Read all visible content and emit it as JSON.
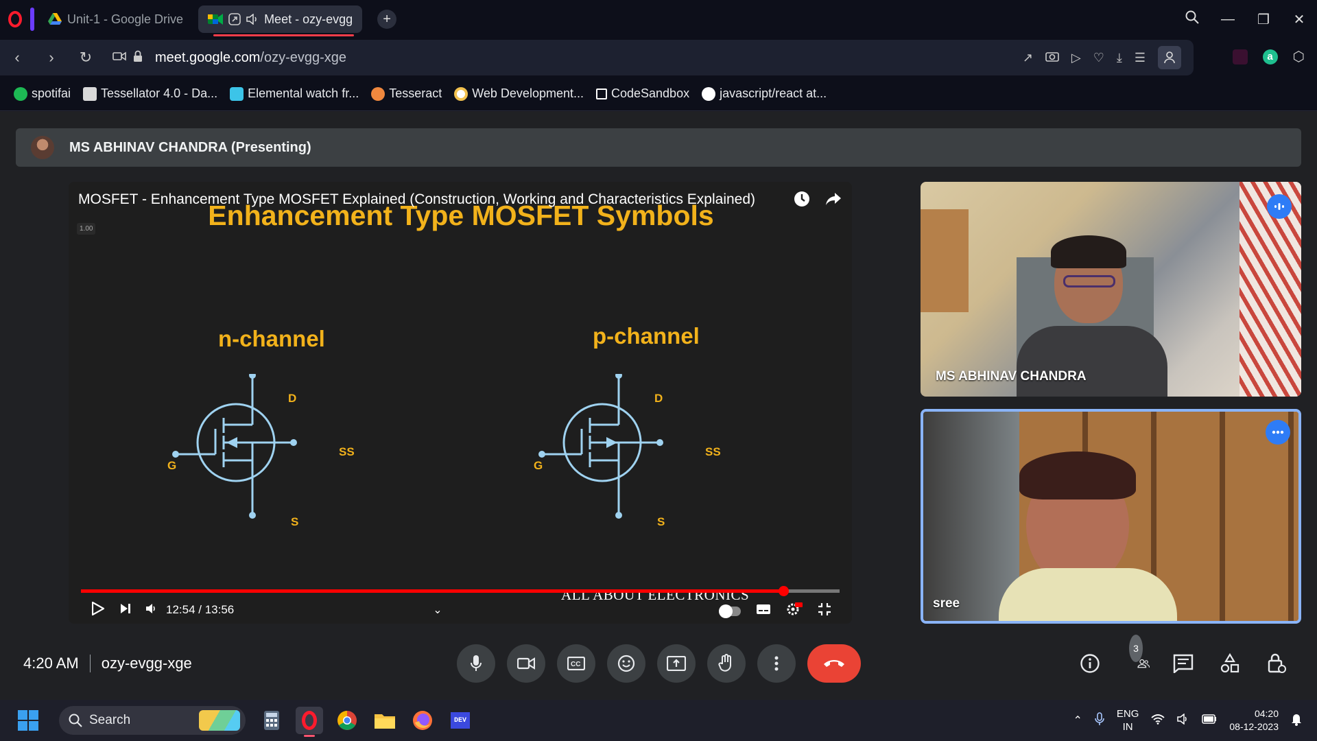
{
  "browser": {
    "tabs": [
      {
        "label": "Unit-1 - Google Drive",
        "active": false
      },
      {
        "label": "Meet - ozy-evgg",
        "active": true
      }
    ],
    "url_domain": "meet.google.com",
    "url_path": "/ozy-evgg-xge",
    "bookmarks": [
      {
        "label": "spotifai",
        "icon": "spotify-icon",
        "color": "#1db954"
      },
      {
        "label": "Tessellator 4.0 - Da...",
        "icon": "tessellator-icon",
        "color": "#d9d9d9"
      },
      {
        "label": "Elemental watch fr...",
        "icon": "s-icon",
        "color": "#3cc4e8"
      },
      {
        "label": "Tesseract",
        "icon": "tesseract-icon",
        "color": "#f0883e"
      },
      {
        "label": "Web Development...",
        "icon": "web-dev-icon",
        "color": "#f2c14e"
      },
      {
        "label": "CodeSandbox",
        "icon": "codesandbox-icon",
        "color": "#ffffff"
      },
      {
        "label": "javascript/react at...",
        "icon": "github-icon",
        "color": "#ffffff"
      }
    ]
  },
  "meet": {
    "presenter_label": "MS ABHINAV CHANDRA (Presenting)",
    "video": {
      "title": "MOSFET - Enhancement Type MOSFET Explained (Construction, Working and Characteristics Explained)",
      "speed_label": "1.00",
      "slide_heading": "Enhancement Type MOSFET Symbols",
      "n_channel": "n-channel",
      "p_channel": "p-channel",
      "terminals": {
        "drain": "D",
        "gate": "G",
        "source": "S",
        "substrate": "SS"
      },
      "time": "12:54 / 13:56",
      "progress": 0.926,
      "watermark": "ALL ABOUT ELECTRONICS"
    },
    "participants": [
      {
        "name": "MS ABHINAV CHANDRA"
      },
      {
        "name": "sree"
      }
    ],
    "clock": "4:20 AM",
    "meeting_code": "ozy-evgg-xge",
    "people_count": "3"
  },
  "taskbar": {
    "search_label": "Search",
    "lang_top": "ENG",
    "lang_bottom": "IN",
    "time": "04:20",
    "date": "08-12-2023"
  },
  "colors": {
    "accent_red": "#ea4335",
    "slide_yellow": "#f2b21b",
    "symbol_blue": "#9fd2f0",
    "speaking_blue": "#2e7cf6"
  }
}
